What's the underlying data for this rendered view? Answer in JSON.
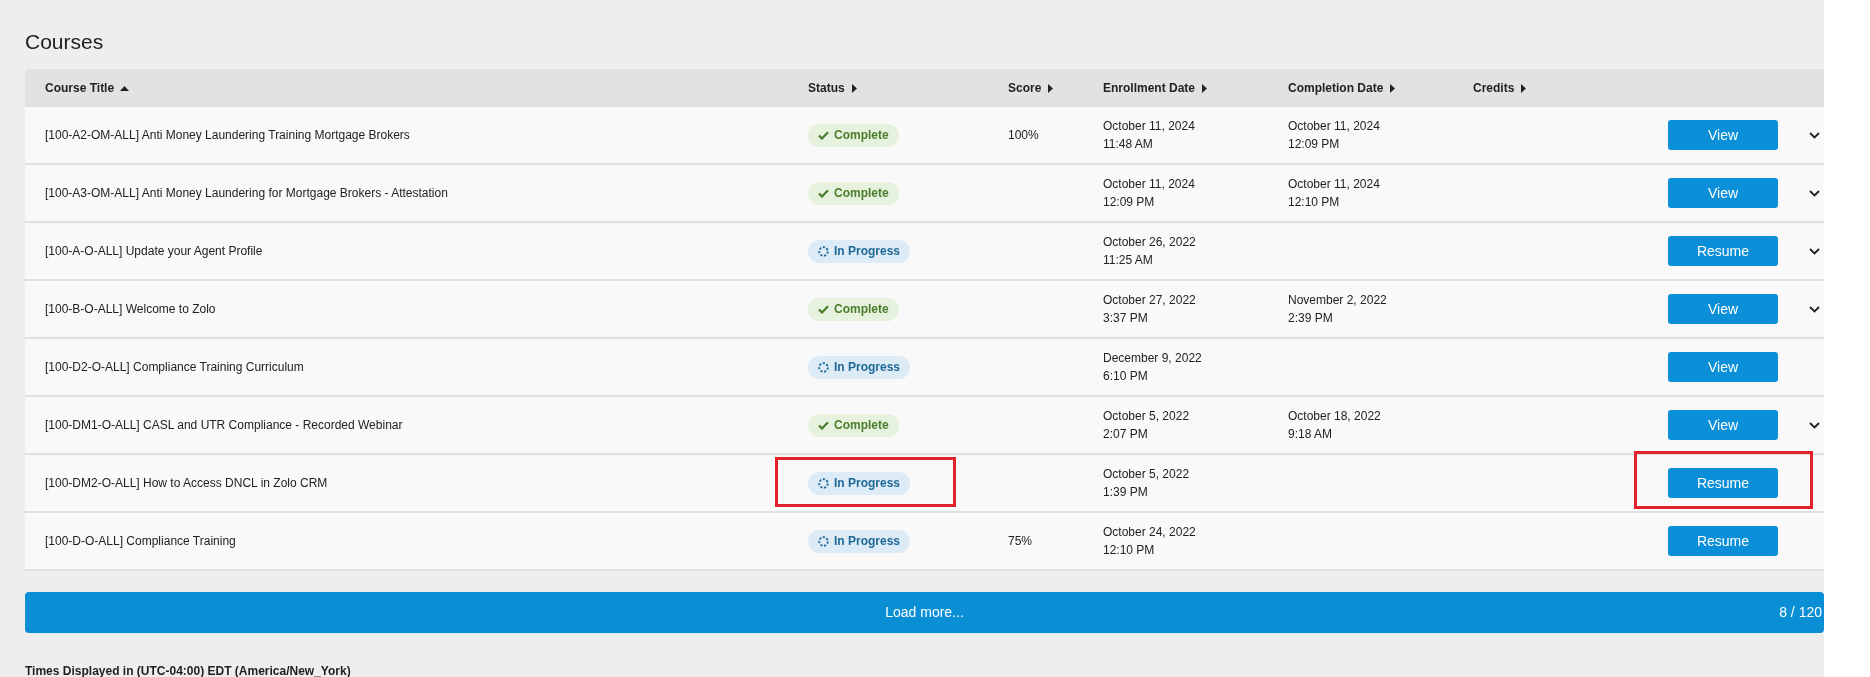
{
  "page_title": "Courses",
  "table": {
    "columns": [
      {
        "label": "Course Title",
        "sorted": true
      },
      {
        "label": "Status",
        "sorted": false
      },
      {
        "label": "Score",
        "sorted": false
      },
      {
        "label": "Enrollment Date",
        "sorted": false
      },
      {
        "label": "Completion Date",
        "sorted": false
      },
      {
        "label": "Credits",
        "sorted": false
      }
    ],
    "rows": [
      {
        "title": "[100-A2-OM-ALL] Anti Money Laundering Training Mortgage Brokers",
        "status": {
          "kind": "complete",
          "label": "Complete"
        },
        "score": "100%",
        "enrollment": {
          "date": "October 11, 2024",
          "time": "11:48 AM"
        },
        "completion": {
          "date": "October 11, 2024",
          "time": "12:09 PM"
        },
        "action": "View",
        "expandable": true,
        "status_highlighted": false,
        "action_highlighted": false
      },
      {
        "title": "[100-A3-OM-ALL] Anti Money Laundering for Mortgage Brokers - Attestation",
        "status": {
          "kind": "complete",
          "label": "Complete"
        },
        "enrollment": {
          "date": "October 11, 2024",
          "time": "12:09 PM"
        },
        "completion": {
          "date": "October 11, 2024",
          "time": "12:10 PM"
        },
        "action": "View",
        "expandable": true,
        "status_highlighted": false,
        "action_highlighted": false
      },
      {
        "title": "[100-A-O-ALL] Update your Agent Profile",
        "status": {
          "kind": "in_progress",
          "label": "In Progress"
        },
        "enrollment": {
          "date": "October 26, 2022",
          "time": "11:25 AM"
        },
        "action": "Resume",
        "expandable": true,
        "status_highlighted": false,
        "action_highlighted": false
      },
      {
        "title": "[100-B-O-ALL] Welcome to Zolo",
        "status": {
          "kind": "complete",
          "label": "Complete"
        },
        "enrollment": {
          "date": "October 27, 2022",
          "time": "3:37 PM"
        },
        "completion": {
          "date": "November 2, 2022",
          "time": "2:39 PM"
        },
        "action": "View",
        "expandable": true,
        "status_highlighted": false,
        "action_highlighted": false
      },
      {
        "title": "[100-D2-O-ALL] Compliance Training Curriculum",
        "status": {
          "kind": "in_progress",
          "label": "In Progress"
        },
        "enrollment": {
          "date": "December 9, 2022",
          "time": "6:10 PM"
        },
        "action": "View",
        "expandable": false,
        "status_highlighted": false,
        "action_highlighted": false
      },
      {
        "title": "[100-DM1-O-ALL] CASL and UTR Compliance - Recorded Webinar",
        "status": {
          "kind": "complete",
          "label": "Complete"
        },
        "enrollment": {
          "date": "October 5, 2022",
          "time": "2:07 PM"
        },
        "completion": {
          "date": "October 18, 2022",
          "time": "9:18 AM"
        },
        "action": "View",
        "expandable": true,
        "status_highlighted": false,
        "action_highlighted": false
      },
      {
        "title": "[100-DM2-O-ALL] How to Access DNCL in Zolo CRM",
        "status": {
          "kind": "in_progress",
          "label": "In Progress"
        },
        "enrollment": {
          "date": "October 5, 2022",
          "time": "1:39 PM"
        },
        "action": "Resume",
        "expandable": false,
        "status_highlighted": true,
        "action_highlighted": true
      },
      {
        "title": "[100-D-O-ALL] Compliance Training",
        "status": {
          "kind": "in_progress",
          "label": "In Progress"
        },
        "score": "75%",
        "enrollment": {
          "date": "October 24, 2022",
          "time": "12:10 PM"
        },
        "action": "Resume",
        "expandable": false,
        "status_highlighted": false,
        "action_highlighted": false
      }
    ]
  },
  "load_more": {
    "label": "Load more...",
    "count": "8 / 120"
  },
  "timezone_note": "Times Displayed in (UTC-04:00) EDT (America/New_York)"
}
